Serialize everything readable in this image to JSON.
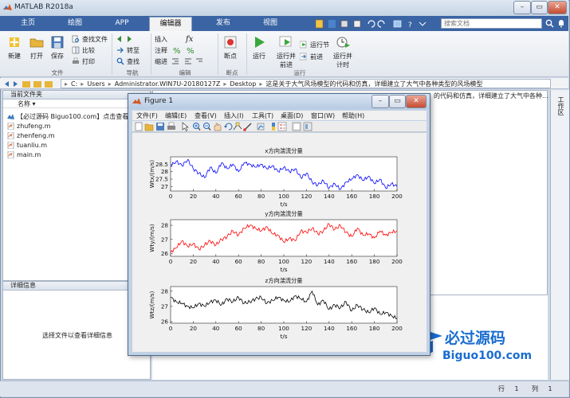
{
  "window": {
    "title": "MATLAB R2018a"
  },
  "tabs": [
    {
      "label": "主页",
      "active": false
    },
    {
      "label": "绘图",
      "active": false
    },
    {
      "label": "APP",
      "active": false
    },
    {
      "label": "编辑器",
      "active": true
    },
    {
      "label": "发布",
      "active": false
    },
    {
      "label": "视图",
      "active": false
    }
  ],
  "search": {
    "placeholder": "搜索文档"
  },
  "toolstrip": {
    "new": "新建",
    "open": "打开",
    "save": "保存",
    "find_files": "查找文件",
    "compare": "比较",
    "print": "打印",
    "goto": "转至",
    "find": "查找",
    "insert": "插入",
    "fx": "fx",
    "comment": "注释",
    "indent": "缩进",
    "breakpoints": "断点",
    "run": "运行",
    "run_advance": [
      "运行并",
      "前进"
    ],
    "run_section": "运行节",
    "advance": "前进",
    "run_time": [
      "运行并",
      "计时"
    ],
    "groups": {
      "file": "文件",
      "nav": "导航",
      "edit": "编辑",
      "bp": "断点",
      "run": "运行"
    }
  },
  "address": {
    "segments": [
      "C:",
      "Users",
      "Administrator.WIN7U-20180127Z",
      "Desktop",
      "这是关于大气风场模型的代码和仿真，详细建立了大气中各种类型的风场模型"
    ]
  },
  "current_folder": {
    "title": "当前文件夹",
    "column_name": "名称",
    "files": [
      {
        "name": "【必过源码 Biguo100.com】点击查看",
        "kind": "html"
      },
      {
        "name": "zhufeng.m",
        "kind": "m"
      },
      {
        "name": "zhenfeng.m",
        "kind": "m"
      },
      {
        "name": "tuanliu.m",
        "kind": "m"
      },
      {
        "name": "main.m",
        "kind": "m"
      }
    ]
  },
  "details": {
    "title": "详细信息",
    "empty_text": "选择文件以查看详细信息"
  },
  "right_panel": {
    "partial_text": "的代码和仿真，详细建立了大气中各种..."
  },
  "right_edge_label": "工作区",
  "status": {
    "row_label": "行",
    "row_value": "1",
    "col_label": "列",
    "col_value": "1"
  },
  "figure": {
    "title": "Figure 1",
    "menu": [
      "文件(F)",
      "编辑(E)",
      "查看(V)",
      "插入(I)",
      "工具(T)",
      "桌面(D)",
      "窗口(W)",
      "帮助(H)"
    ]
  },
  "chart_data": [
    {
      "type": "line",
      "title": "x方向湍流分量",
      "xlabel": "t/s",
      "ylabel": "Wtx/(m/s)",
      "xlim": [
        0,
        200
      ],
      "ylim": [
        26.7,
        29.0
      ],
      "xticks": [
        0,
        20,
        40,
        60,
        80,
        100,
        120,
        140,
        160,
        180,
        200
      ],
      "yticks": [
        27,
        27.5,
        28,
        28.5
      ],
      "ytick_labels": [
        "27",
        "27.5",
        "28",
        "28.5"
      ],
      "color": "#0000ff",
      "series": [
        {
          "x": [
            0,
            5,
            10,
            15,
            20,
            25,
            30,
            35,
            40,
            45,
            50,
            55,
            60,
            65,
            70,
            75,
            80,
            85,
            90,
            95,
            100,
            105,
            110,
            115,
            120,
            125,
            130,
            135,
            140,
            145,
            150,
            155,
            160,
            165,
            170,
            175,
            180,
            185,
            190,
            195,
            200
          ],
          "values": [
            28.4,
            28.7,
            28.4,
            28.8,
            28.2,
            27.9,
            27.6,
            28.3,
            27.9,
            28.6,
            28.2,
            28.5,
            28.0,
            28.6,
            28.5,
            28.3,
            28.5,
            28.2,
            28.4,
            28.0,
            28.3,
            28.0,
            28.2,
            27.6,
            27.9,
            27.3,
            27.1,
            27.4,
            26.9,
            27.2,
            26.8,
            27.3,
            27.5,
            27.8,
            27.4,
            27.7,
            27.2,
            27.5,
            26.9,
            27.2,
            27.0
          ]
        }
      ]
    },
    {
      "type": "line",
      "title": "y方向湍流分量",
      "xlabel": "t/s",
      "ylabel": "Wty/(m/s)",
      "xlim": [
        0,
        200
      ],
      "ylim": [
        25.8,
        28.4
      ],
      "xticks": [
        0,
        20,
        40,
        60,
        80,
        100,
        120,
        140,
        160,
        180,
        200
      ],
      "yticks": [
        26,
        27,
        28
      ],
      "ytick_labels": [
        "26",
        "27",
        "28"
      ],
      "color": "#ff0000",
      "series": [
        {
          "x": [
            0,
            5,
            10,
            15,
            20,
            25,
            30,
            35,
            40,
            45,
            50,
            55,
            60,
            65,
            70,
            75,
            80,
            85,
            90,
            95,
            100,
            105,
            110,
            115,
            120,
            125,
            130,
            135,
            140,
            145,
            150,
            155,
            160,
            165,
            170,
            175,
            180,
            185,
            190,
            195,
            200
          ],
          "values": [
            26.1,
            26.4,
            26.9,
            26.5,
            26.7,
            26.3,
            26.6,
            26.9,
            26.6,
            27.0,
            27.2,
            27.6,
            27.3,
            27.8,
            28.0,
            27.8,
            27.6,
            27.9,
            27.4,
            27.3,
            26.8,
            27.1,
            26.9,
            27.6,
            27.5,
            27.8,
            27.4,
            27.6,
            28.1,
            27.7,
            28.0,
            27.5,
            27.2,
            27.8,
            27.3,
            27.4,
            27.1,
            27.6,
            27.3,
            27.5,
            27.6
          ]
        }
      ]
    },
    {
      "type": "line",
      "title": "z方向湍流分量",
      "xlabel": "t/s",
      "ylabel": "Wtz/(m/s)",
      "xlim": [
        0,
        200
      ],
      "ylim": [
        25.9,
        28.3
      ],
      "xticks": [
        0,
        20,
        40,
        60,
        80,
        100,
        120,
        140,
        160,
        180,
        200
      ],
      "yticks": [
        26,
        27,
        28
      ],
      "ytick_labels": [
        "26",
        "27",
        "28"
      ],
      "color": "#000000",
      "series": [
        {
          "x": [
            0,
            5,
            10,
            15,
            20,
            25,
            30,
            35,
            40,
            45,
            50,
            55,
            60,
            65,
            70,
            75,
            80,
            85,
            90,
            95,
            100,
            105,
            110,
            115,
            120,
            125,
            130,
            135,
            140,
            145,
            150,
            155,
            160,
            165,
            170,
            175,
            180,
            185,
            190,
            195,
            200
          ],
          "values": [
            27.6,
            27.3,
            27.2,
            27.0,
            26.9,
            27.2,
            27.0,
            27.3,
            27.4,
            27.1,
            27.5,
            27.3,
            27.6,
            27.2,
            27.3,
            27.5,
            27.6,
            27.2,
            27.4,
            27.6,
            27.4,
            27.3,
            27.7,
            27.5,
            27.3,
            28.0,
            27.1,
            27.4,
            26.8,
            27.1,
            26.9,
            27.3,
            26.7,
            27.1,
            26.8,
            26.6,
            26.9,
            26.5,
            26.6,
            26.4,
            26.2
          ]
        }
      ]
    }
  ]
}
